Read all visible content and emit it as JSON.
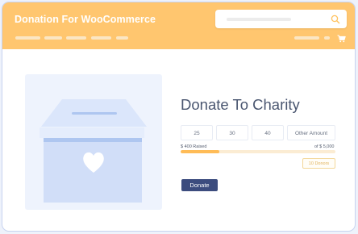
{
  "header": {
    "brand_title": "Donation For WooCommerce",
    "search": {
      "placeholder": ""
    },
    "colors": {
      "accent": "#ffc66f"
    }
  },
  "campaign": {
    "title": "Donate To Charity",
    "amount_options": [
      "25",
      "30",
      "40",
      "Other Amount"
    ],
    "raised_label": "$ 400 Raised",
    "goal_label": "of $ 5,000",
    "donors_badge": "10 Donors",
    "progress_fraction": 0.25,
    "donate_button": "Donate"
  },
  "icons": [
    "search-icon",
    "cart-icon",
    "donation-box-icon",
    "heart-icon"
  ]
}
